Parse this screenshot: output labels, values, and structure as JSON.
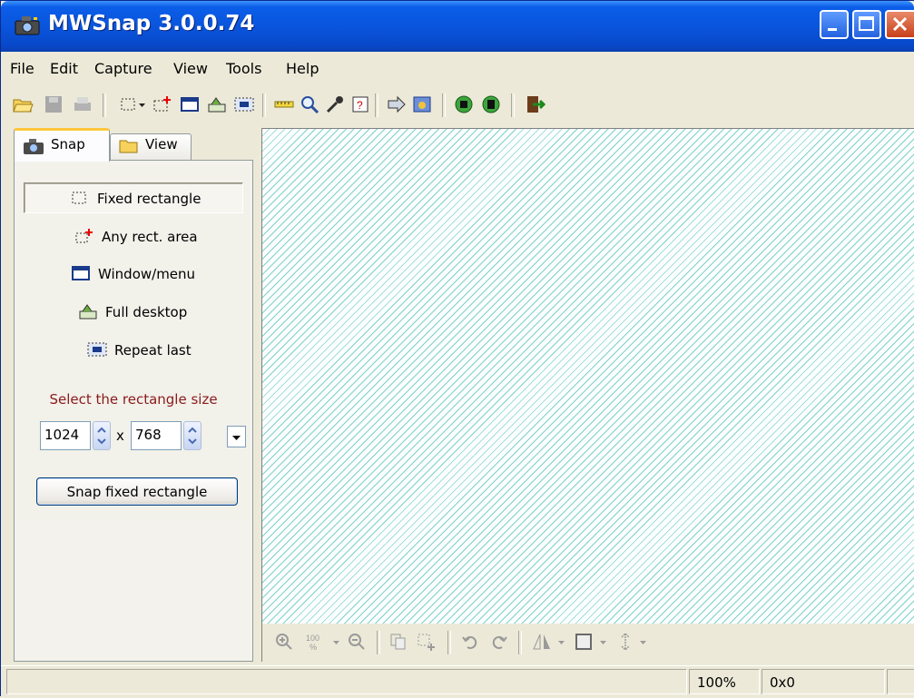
{
  "window": {
    "title": "MWSnap 3.0.0.74"
  },
  "menu": {
    "items": [
      "File",
      "Edit",
      "Capture",
      "View",
      "Tools",
      "Help"
    ]
  },
  "toolbar": {
    "icons": [
      "open-folder-icon",
      "save-icon",
      "print-icon",
      "fixed-rect-icon",
      "dropdown-arrow-icon",
      "any-rect-icon",
      "window-icon",
      "desktop-icon",
      "repeat-icon",
      "ruler-icon",
      "zoom-icon",
      "color-picker-icon",
      "help-icon",
      "arrow-icon",
      "explorer-icon",
      "record-icon",
      "stop-icon",
      "exit-icon"
    ]
  },
  "tabs": {
    "snap": "Snap",
    "view": "View"
  },
  "modes": [
    {
      "label": "Fixed rectangle",
      "icon": "fixed-rectangle-icon",
      "selected": true
    },
    {
      "label": "Any rect. area",
      "icon": "any-rect-area-icon",
      "selected": false
    },
    {
      "label": "Window/menu",
      "icon": "window-menu-icon",
      "selected": false
    },
    {
      "label": "Full desktop",
      "icon": "full-desktop-icon",
      "selected": false
    },
    {
      "label": "Repeat last",
      "icon": "repeat-last-icon",
      "selected": false
    }
  ],
  "size": {
    "prompt": "Select the rectangle size",
    "width": "1024",
    "height": "768",
    "separator": "x"
  },
  "snap_button": "Snap fixed rectangle",
  "zoom_labels": {
    "preset": "100\n%"
  },
  "status": {
    "zoom": "100%",
    "size": "0x0"
  },
  "colors": {
    "titlebar": "#0a55dd",
    "canvas_stripe": "#7fd0cc",
    "prompt": "#8a1b1b"
  }
}
